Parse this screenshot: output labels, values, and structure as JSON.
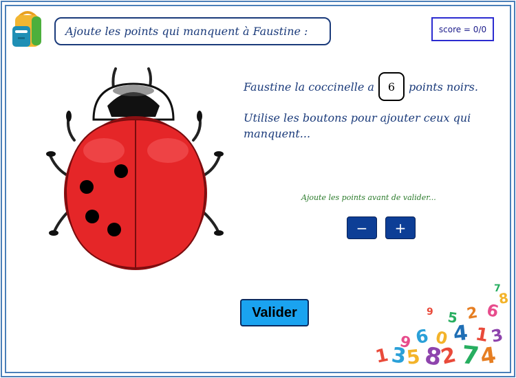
{
  "header": {
    "title": "Ajoute les points qui manquent à Faustine :",
    "score": "score = 0/0"
  },
  "exercise": {
    "sentence_start": "Faustine la coccinelle a",
    "dot_count": "6",
    "sentence_end": "points noirs.",
    "instruction": "Utilise les boutons pour ajouter ceux qui manquent...",
    "hint": "Ajoute les points avant de valider...",
    "dots_on_ladybug": 4
  },
  "controls": {
    "minus_label": "−",
    "plus_label": "+",
    "validate_label": "Valider"
  },
  "colors": {
    "frame": "#4a7fb8",
    "title_text": "#1a3a7a",
    "hint_text": "#2a7a2a",
    "button_bg": "#0d3e96",
    "validate_bg": "#1aa3f0",
    "ladybug_red": "#e52628"
  }
}
